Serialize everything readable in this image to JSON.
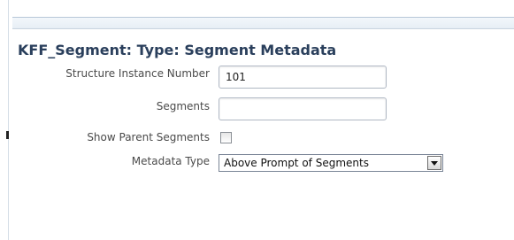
{
  "page": {
    "title": "KFF_Segment: Type: Segment Metadata"
  },
  "form": {
    "structure_instance_number": {
      "label": "Structure Instance Number",
      "value": "101"
    },
    "segments": {
      "label": "Segments",
      "value": ""
    },
    "show_parent_segments": {
      "label": "Show Parent Segments",
      "checked": false
    },
    "metadata_type": {
      "label": "Metadata Type",
      "selected": "Above Prompt of Segments"
    }
  },
  "colors": {
    "title": "#2a3f5c",
    "label": "#4a4a4a",
    "input_border": "#b0b8c4"
  },
  "icons": {
    "dropdown": "chevron-down-icon"
  }
}
